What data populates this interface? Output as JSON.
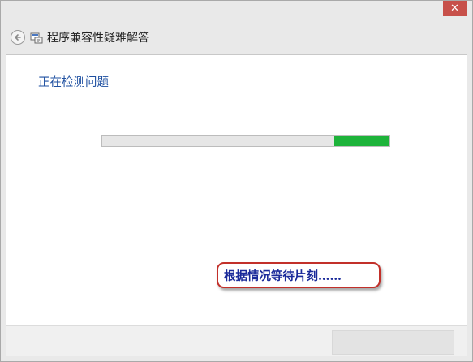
{
  "window": {
    "title": "程序兼容性疑难解答",
    "close_glyph": "✕",
    "back_icon": "back-arrow-icon",
    "app_icon": "troubleshooter-icon"
  },
  "main": {
    "heading": "正在检测问题",
    "progress": {
      "indeterminate": true,
      "indicator_color": "#1db33a"
    }
  },
  "callout": {
    "text": "根据情况等待片刻……",
    "border_color": "#c2302a",
    "text_color": "#1a2a9a"
  },
  "colors": {
    "heading": "#1e4fa0",
    "close_button": "#c7504a"
  }
}
